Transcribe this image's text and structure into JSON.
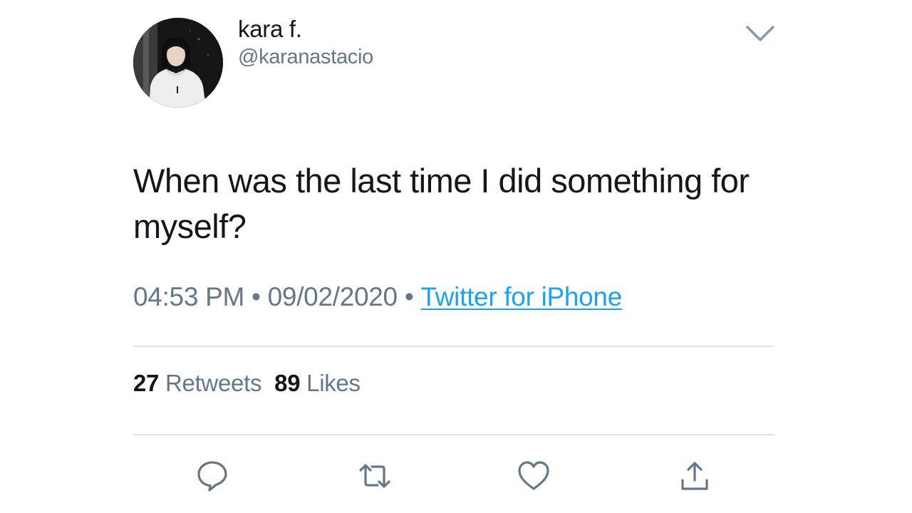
{
  "user": {
    "display_name": "kara f.",
    "handle": "@karanastacio"
  },
  "tweet": {
    "text": "When was the last time I did something for myself?",
    "time": "04:53 PM",
    "date": "09/02/2020",
    "separator": "•",
    "source": "Twitter for iPhone"
  },
  "stats": {
    "retweets_count": "27",
    "retweets_label": "Retweets",
    "likes_count": "89",
    "likes_label": "Likes"
  },
  "actions": {
    "reply_icon": "reply-icon",
    "retweet_icon": "retweet-icon",
    "like_icon": "heart-icon",
    "share_icon": "share-icon"
  },
  "colors": {
    "text_primary": "#14171a",
    "text_secondary": "#657786",
    "link": "#1da1f2",
    "divider": "#dfe3e6"
  }
}
